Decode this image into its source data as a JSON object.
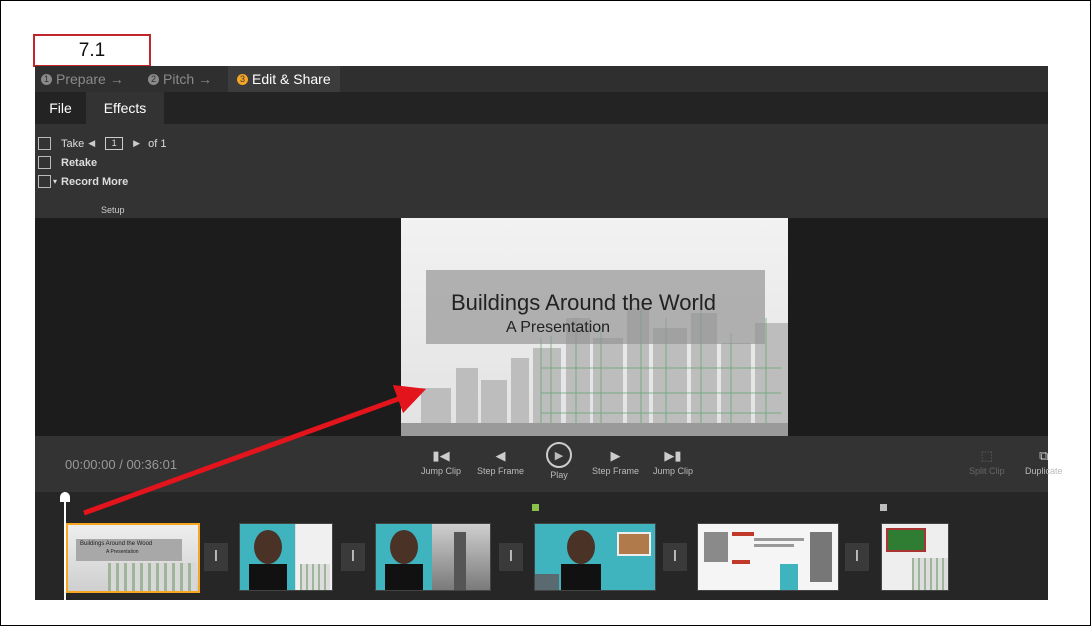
{
  "annotation": {
    "step_label": "7.1"
  },
  "steps": [
    {
      "number": "1",
      "label": "Prepare →"
    },
    {
      "number": "2",
      "label": "Pitch →"
    },
    {
      "number": "3",
      "label": "Edit & Share"
    }
  ],
  "ribbon_tabs": [
    "File",
    "Effects"
  ],
  "ribbon": {
    "take_label": "Take",
    "take_value": "1",
    "take_of": "of 1",
    "retake_label": "Retake",
    "record_more_label": "Record More",
    "group_label": "Setup"
  },
  "slide": {
    "title": "Buildings Around the World",
    "subtitle": "A Presentation"
  },
  "playback": {
    "time": "00:00:00 / 00:36:01",
    "buttons": {
      "jump_clip_back": "Jump Clip",
      "step_frame_back": "Step Frame",
      "play": "Play",
      "step_frame_fwd": "Step Frame",
      "jump_clip_fwd": "Jump Clip",
      "split_clip": "Split Clip",
      "duplicate": "Duplicate"
    }
  },
  "timeline": {
    "clip1_title": "Buildings Around the Wood",
    "clip1_subtitle": "A Presentation",
    "transition_glyph": "I",
    "marker_colors": [
      "#8bc34a",
      "#bdbdbd"
    ]
  },
  "colors": {
    "accent": "#f6a623",
    "annotation_red": "#e3141c",
    "label_border": "#c0262c"
  }
}
